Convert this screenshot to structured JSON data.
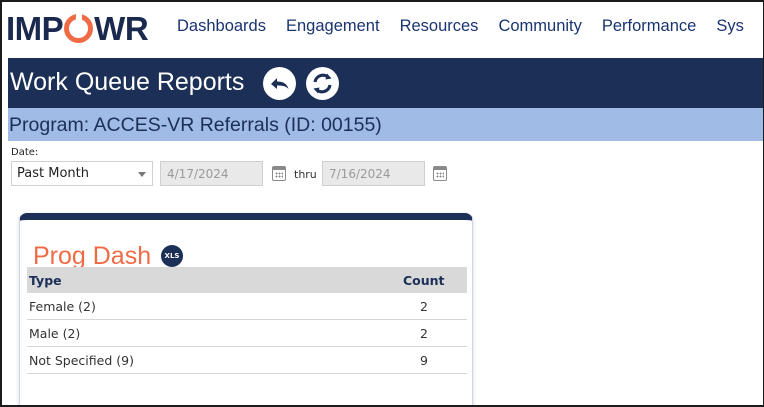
{
  "nav": {
    "logo": {
      "left": "IMP",
      "right": "WR"
    },
    "items": [
      "Dashboards",
      "Engagement",
      "Resources",
      "Community",
      "Performance",
      "Sys"
    ]
  },
  "header": {
    "title": "Work Queue Reports",
    "back_icon": "undo-arrow-icon",
    "refresh_icon": "refresh-icon"
  },
  "program": {
    "label": "Program: ACCES-VR Referrals (ID: 00155)"
  },
  "filters": {
    "date_label": "Date:",
    "period": "Past Month",
    "start_date": "4/17/2024",
    "thru_label": "thru",
    "end_date": "7/16/2024"
  },
  "card": {
    "title": "Prog Dash",
    "export_label": "XLS",
    "columns": [
      "Type",
      "Count"
    ],
    "rows": [
      {
        "type": "Female (2)",
        "count": "2"
      },
      {
        "type": "Male (2)",
        "count": "2"
      },
      {
        "type": "Not Specified (9)",
        "count": "9"
      }
    ]
  },
  "colors": {
    "navy": "#1c2f56",
    "accent_orange": "#ef6b46",
    "program_bar": "#9fbbe6",
    "nav_text": "#1a3470"
  }
}
